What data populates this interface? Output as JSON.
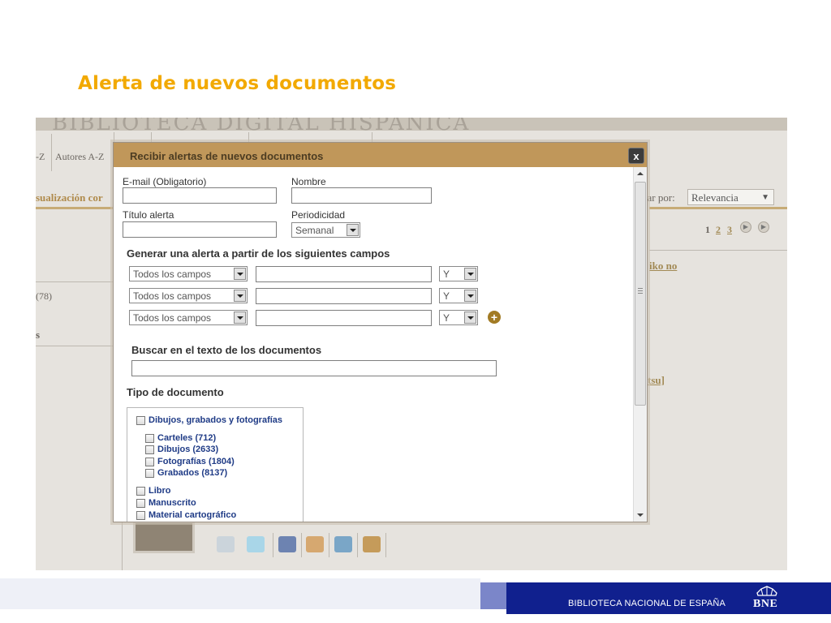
{
  "slide_title": "Alerta de nuevos documentos",
  "background_page": {
    "banner_text": "BIBLIOTECA DIGITAL HISPÁNICA",
    "nav_fragment_left": "-Z",
    "nav_authors": "Autores A-Z",
    "visualization_fragment": "sualización cor",
    "sort_label_fragment": "nar por:",
    "sort_value": "Relevancia",
    "pages": [
      "1",
      "2",
      "3"
    ],
    "count_fragment": "(78)",
    "section_fragment": "s",
    "link_fragment_1": "iko no",
    "link_fragment_2": "tsu]"
  },
  "dialog": {
    "title": "Recibir alertas de nuevos documentos",
    "close_label": "x",
    "email_label": "E-mail (Obligatorio)",
    "email_value": "",
    "name_label": "Nombre",
    "name_value": "",
    "alert_title_label": "Título alerta",
    "alert_title_value": "",
    "periodicity_label": "Periodicidad",
    "periodicity_value": "Semanal",
    "generate_heading": "Generar una alerta a partir de los siguientes campos",
    "criteria_rows": [
      {
        "field": "Todos los campos",
        "term": "",
        "operator": "Y"
      },
      {
        "field": "Todos los campos",
        "term": "",
        "operator": "Y"
      },
      {
        "field": "Todos los campos",
        "term": "",
        "operator": "Y"
      }
    ],
    "add_row_label": "+",
    "fulltext_heading": "Buscar en el texto de los documentos",
    "fulltext_value": "",
    "doctype_heading": "Tipo de documento",
    "doc_group_label": "Dibujos, grabados y fotografías",
    "doc_group_items": [
      "Carteles (712)",
      "Dibujos (2633)",
      "Fotografías (1804)",
      "Grabados (8137)"
    ],
    "doc_other_items": [
      "Libro",
      "Manuscrito",
      "Material cartográfico"
    ]
  },
  "footer": {
    "institution": "BIBLIOTECA NACIONAL DE ESPAÑA",
    "logo_text": "BNE"
  },
  "colors": {
    "title_accent": "#f2a900",
    "dialog_header": "#c0975a",
    "footer_navy": "#10208e",
    "footer_mid": "#7b86c9",
    "link_blue": "#1f3b86"
  }
}
